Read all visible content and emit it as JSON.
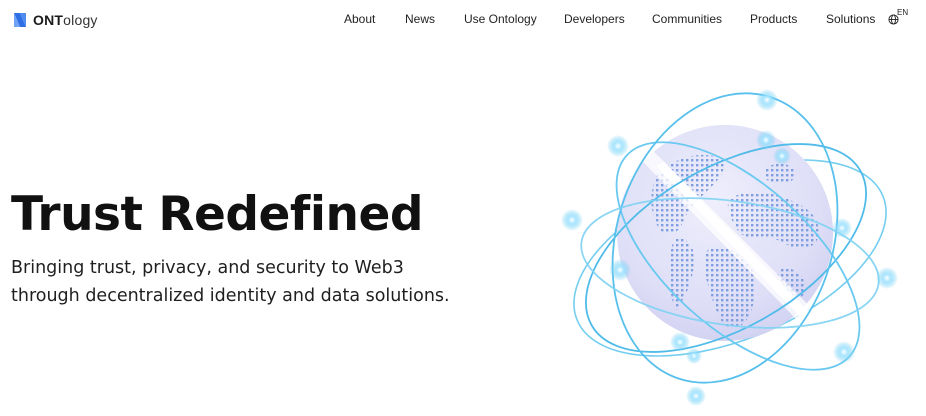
{
  "logo": {
    "prefix": "ONT",
    "suffix": "ology",
    "icon": "ontology-logo-icon"
  },
  "nav": {
    "items": [
      {
        "label": "About"
      },
      {
        "label": "News"
      },
      {
        "label": "Use Ontology"
      },
      {
        "label": "Developers"
      },
      {
        "label": "Communities"
      },
      {
        "label": "Products"
      },
      {
        "label": "Solutions"
      }
    ],
    "language": {
      "label": "EN",
      "icon": "globe-icon"
    }
  },
  "hero": {
    "title": "Trust Redefined",
    "subtitle_line1": "Bringing trust, privacy, and security to Web3",
    "subtitle_line2": "through decentralized identity and data solutions."
  },
  "colors": {
    "brand": "#3d7bf0",
    "orbit": "#5ec6ee",
    "globe": "#dcdcf6"
  }
}
